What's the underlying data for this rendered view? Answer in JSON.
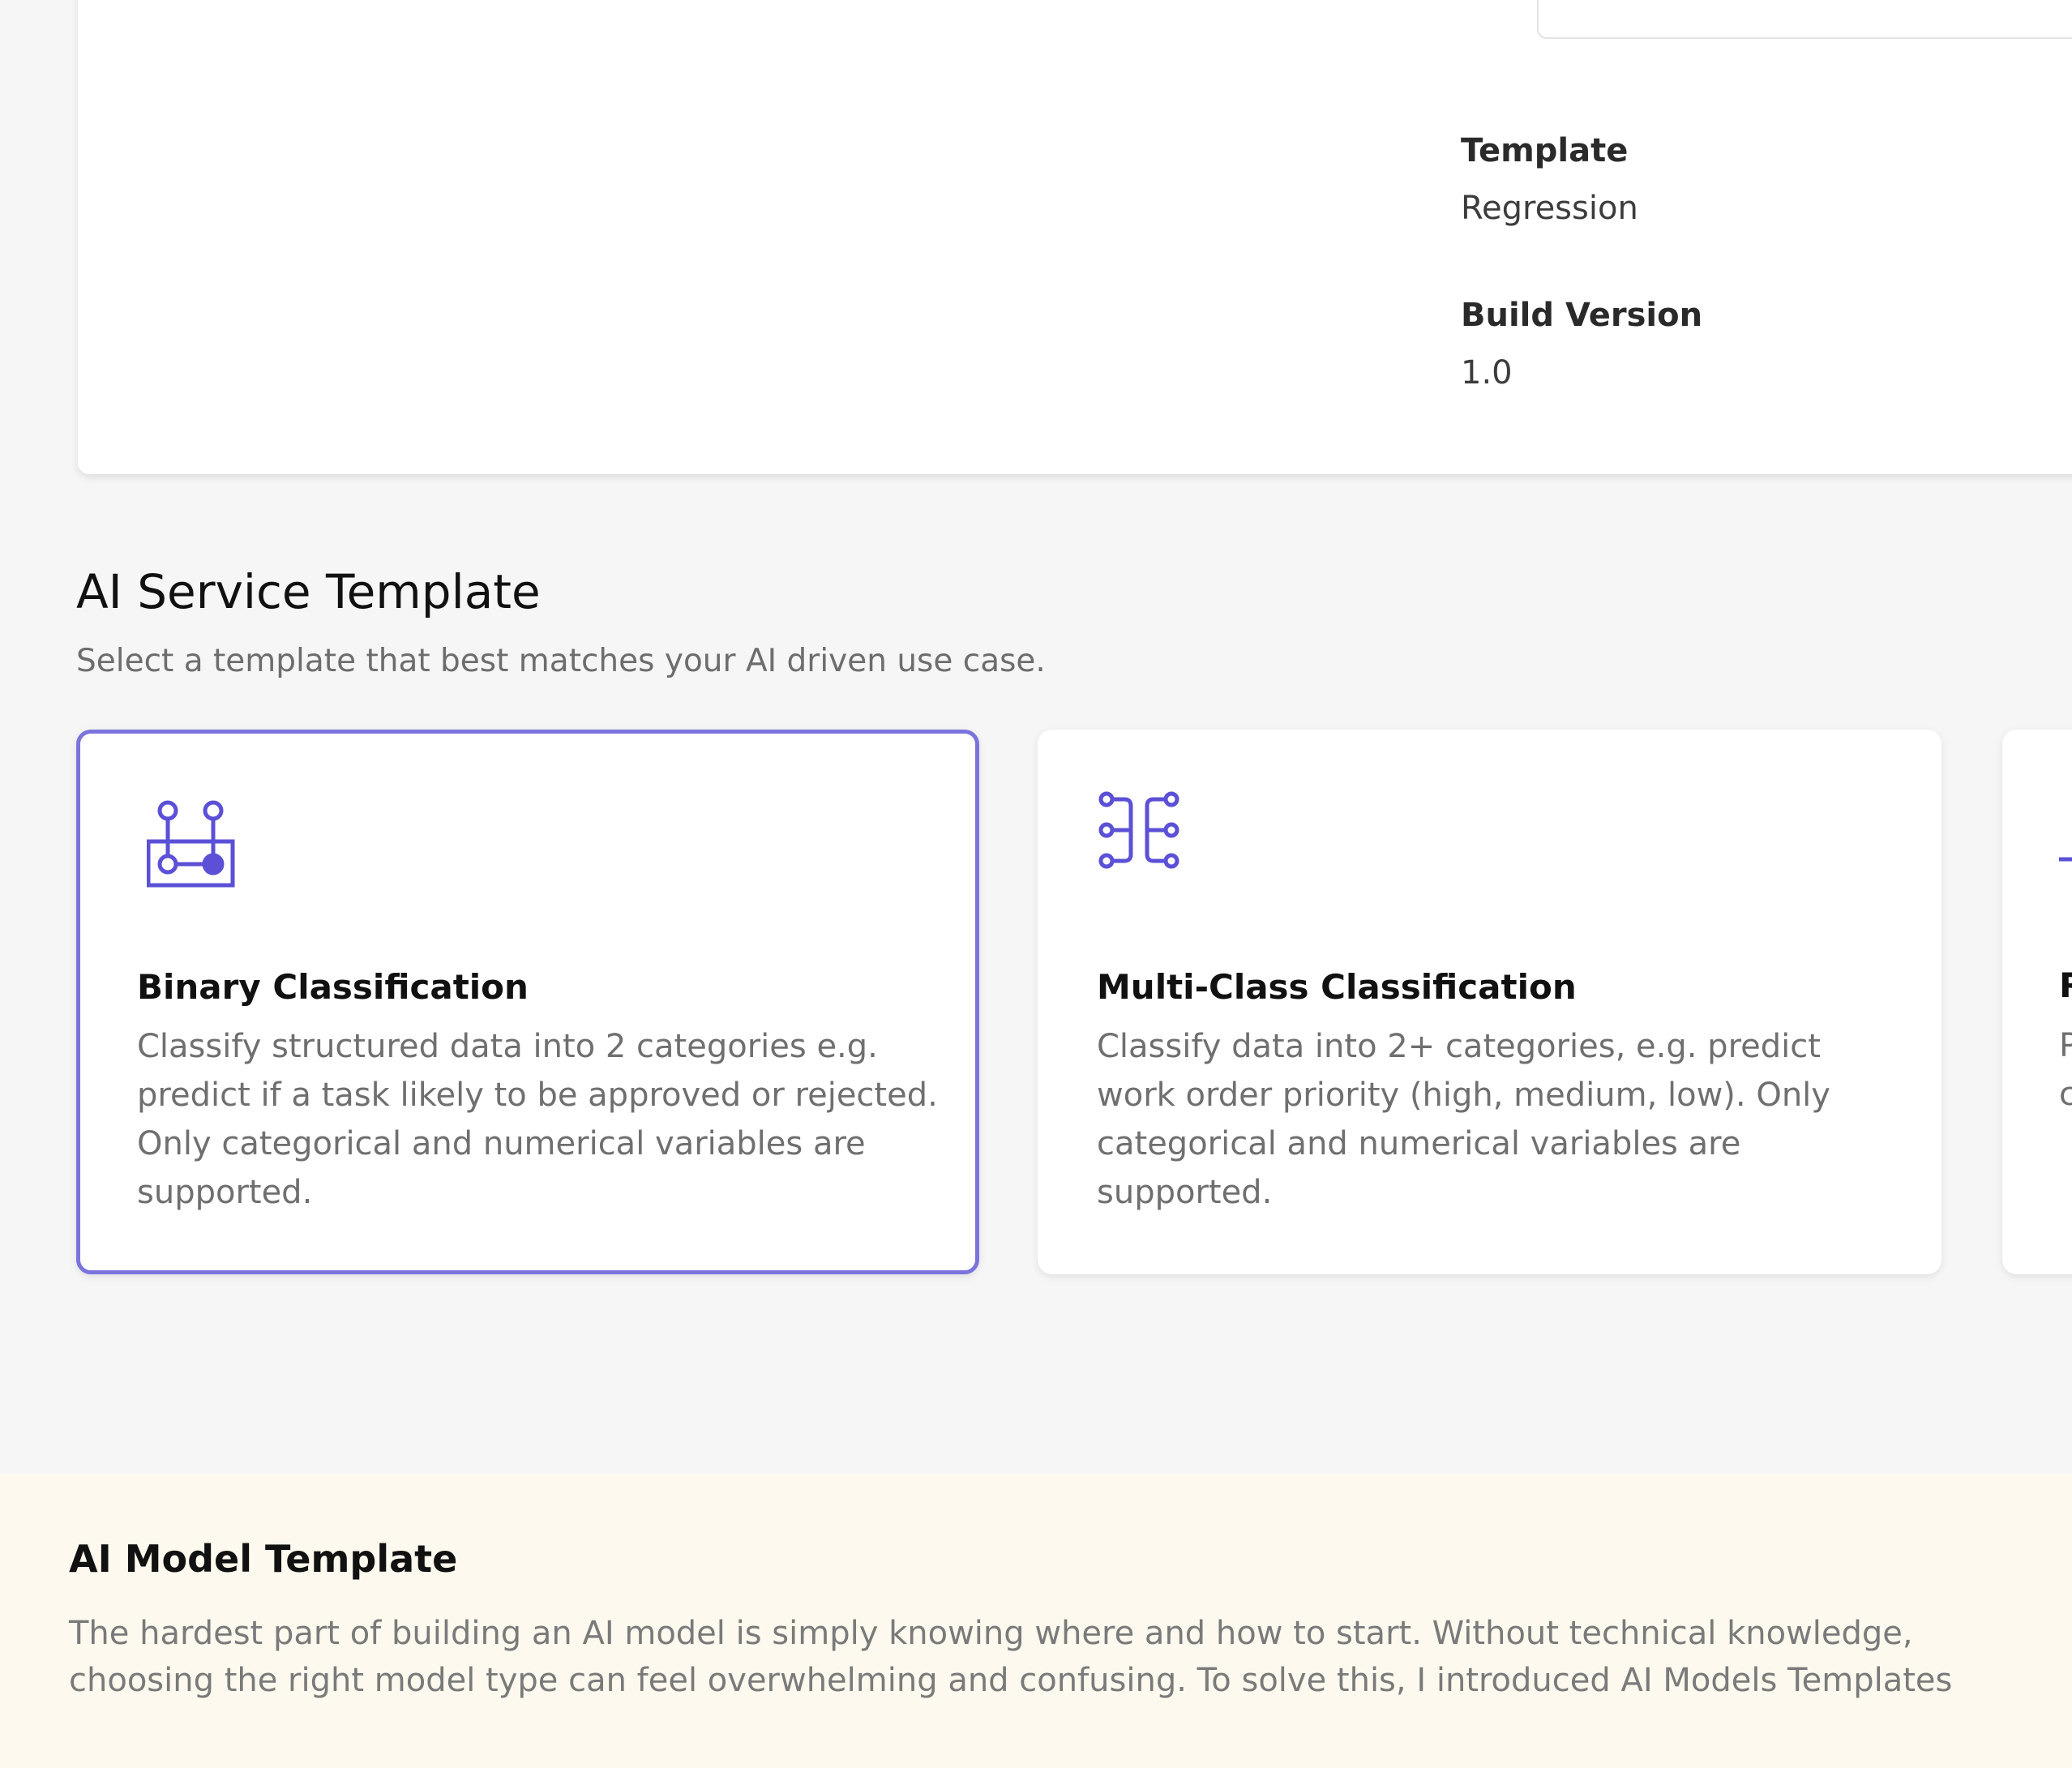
{
  "details": {
    "fields": [
      {
        "label": "Template",
        "value": "Regression"
      },
      {
        "label": "Build Version",
        "value": "1.0"
      }
    ]
  },
  "section": {
    "title": "AI Service Template",
    "subtitle": "Select a template that best matches your AI driven use case."
  },
  "templates": [
    {
      "title": "Binary Classification",
      "description": "Classify structured data into 2 categories e.g. predict if a task likely to be approved or rejected. Only categorical and numerical variables are supported.",
      "icon": "binary-classification-icon",
      "selected": true
    },
    {
      "title": "Multi-Class Classification",
      "description": "Classify data into 2+ categories, e.g. predict work order priority (high, medium, low). Only categorical and numerical variables are supported.",
      "icon": "multi-class-classification-icon",
      "selected": false
    },
    {
      "title": "R",
      "description": "P c",
      "icon": "regression-icon",
      "selected": false
    }
  ],
  "note": {
    "title": "AI Model Template",
    "body": "The hardest part of building an AI model is simply knowing where and how to start. Without technical knowledge, choosing the right model type can feel overwhelming and confusing. To solve this, I introduced AI Models Templates"
  },
  "colors": {
    "accent": "#5b50d6",
    "selected_border": "#7b74dd",
    "note_background": "#fdf9ee",
    "page_background": "#f6f6f6"
  }
}
